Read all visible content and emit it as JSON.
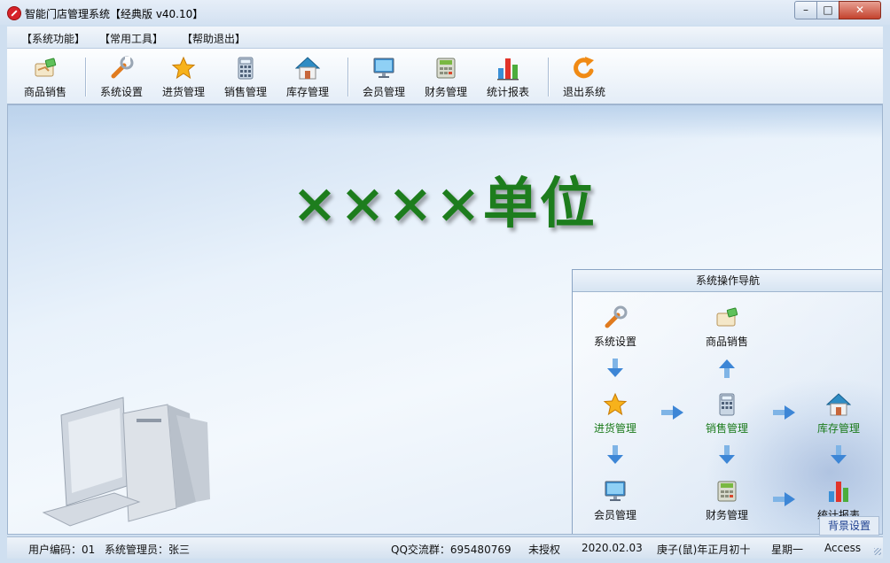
{
  "window": {
    "title": "智能门店管理系统【经典版 v40.10】",
    "controls": {
      "minimize": "–",
      "maximize": "□",
      "close": "✕"
    }
  },
  "menu": [
    {
      "label": "【系统功能】"
    },
    {
      "label": "【常用工具】"
    },
    {
      "label": "【帮助退出】"
    }
  ],
  "toolbar": [
    {
      "label": "商品销售",
      "icon": "product-sales-icon"
    },
    {
      "label": "系统设置",
      "icon": "wrench-icon"
    },
    {
      "label": "进货管理",
      "icon": "star-icon"
    },
    {
      "label": "销售管理",
      "icon": "calculator-icon"
    },
    {
      "label": "库存管理",
      "icon": "house-icon"
    },
    {
      "label": "会员管理",
      "icon": "monitor-icon"
    },
    {
      "label": "财务管理",
      "icon": "cash-register-icon"
    },
    {
      "label": "统计报表",
      "icon": "bar-chart-icon"
    },
    {
      "label": "退出系统",
      "icon": "exit-arrow-icon"
    }
  ],
  "main": {
    "unit_title": "××××单位"
  },
  "nav_panel": {
    "title": "系统操作导航",
    "items": [
      {
        "label": "系统设置"
      },
      {
        "label": "商品销售"
      },
      {
        "label": "进货管理"
      },
      {
        "label": "销售管理"
      },
      {
        "label": "库存管理"
      },
      {
        "label": "会员管理"
      },
      {
        "label": "财务管理"
      },
      {
        "label": "统计报表"
      }
    ],
    "background_button": "背景设置"
  },
  "status": {
    "user_code": "用户编码：01",
    "user_name": "系统管理员：张三",
    "qq_group": "QQ交流群：695480769",
    "license": "未授权",
    "date": "2020.02.03",
    "lunar_date": "庚子(鼠)年正月初十",
    "weekday": "星期一",
    "database": "Access"
  },
  "colors": {
    "title_green": "#1d7d1d",
    "nav_green_label": "#1a7a1a"
  }
}
